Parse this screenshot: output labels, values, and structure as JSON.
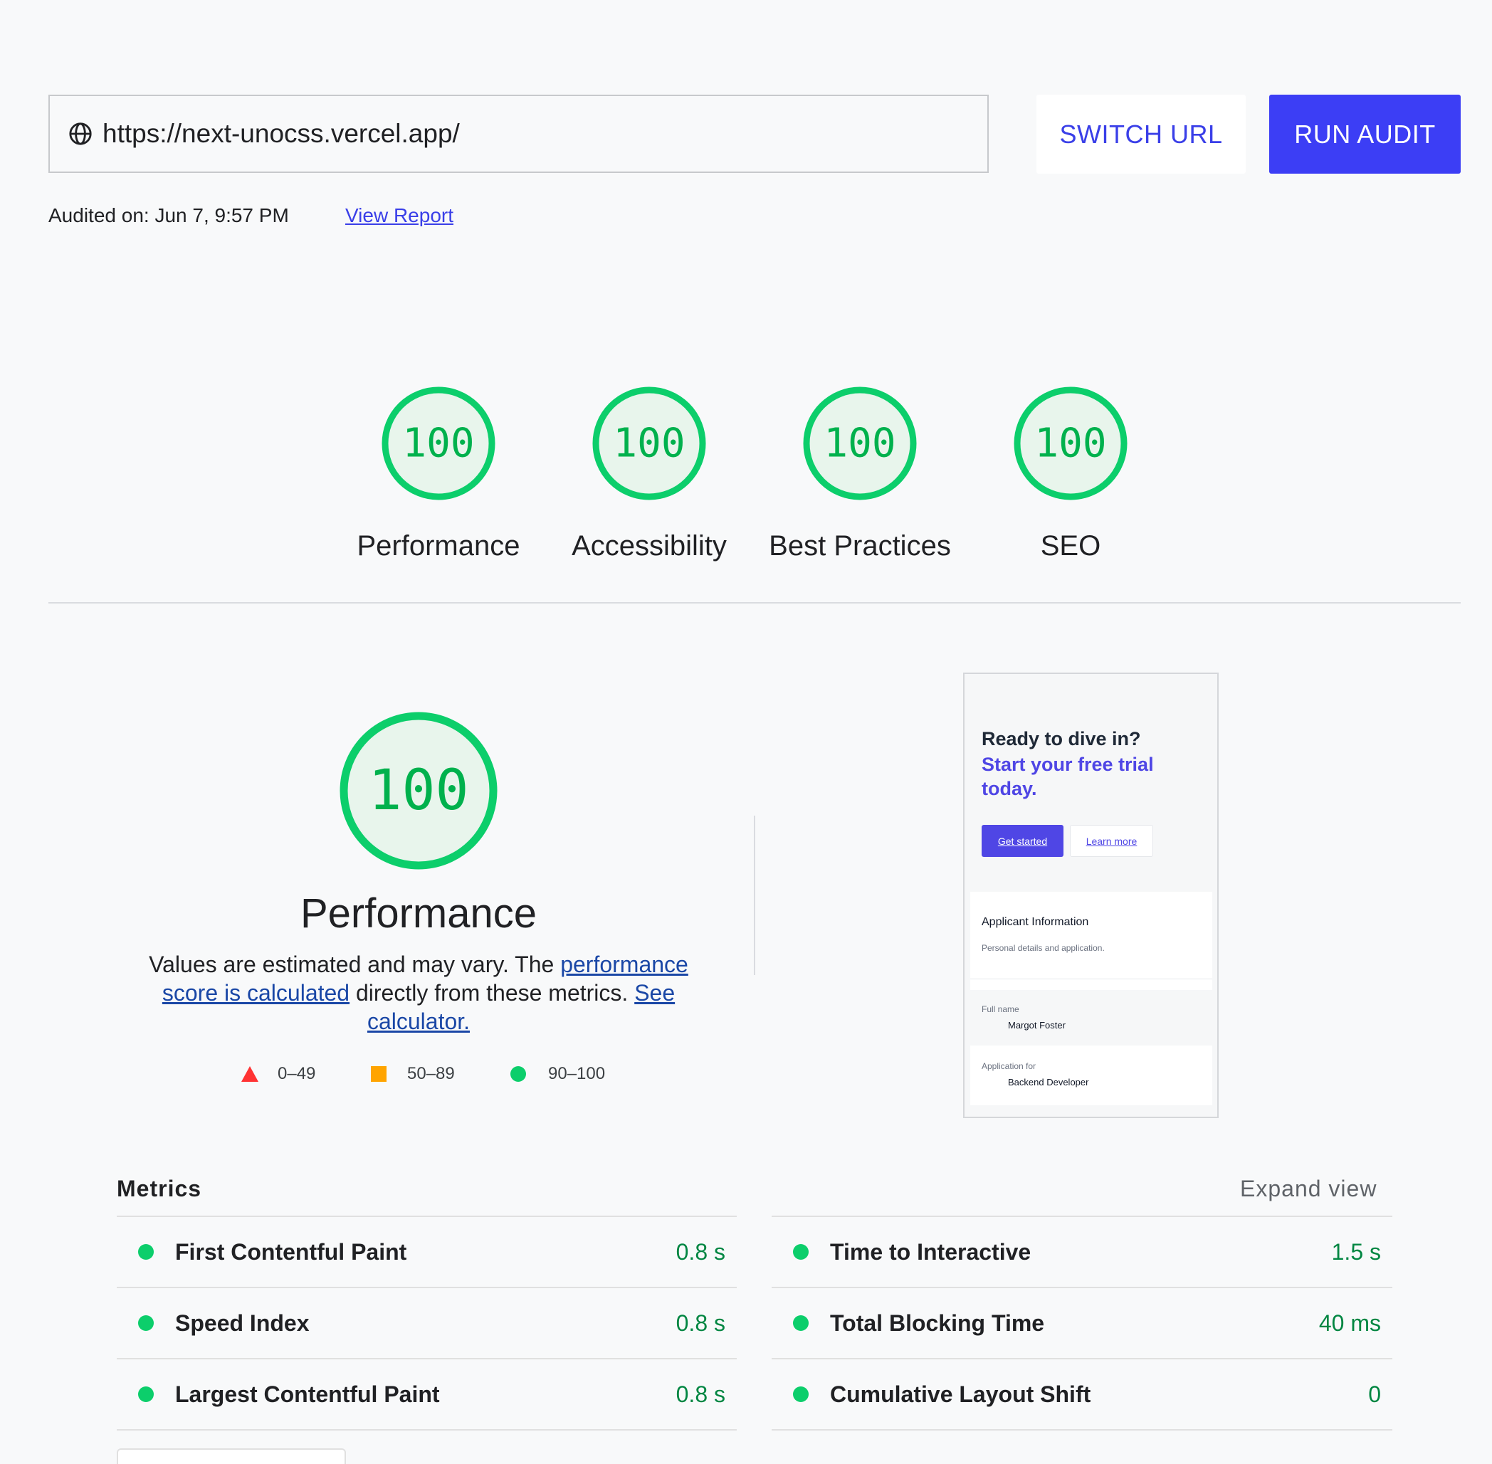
{
  "url_bar": {
    "url": "https://next-unocss.vercel.app/",
    "icon": "globe-icon"
  },
  "buttons": {
    "switch_url": "SWITCH URL",
    "run_audit": "RUN AUDIT"
  },
  "audit": {
    "audited_on": "Audited on: Jun 7, 9:57 PM",
    "view_report": "View Report"
  },
  "scores": [
    {
      "label": "Performance",
      "score": "100"
    },
    {
      "label": "Accessibility",
      "score": "100"
    },
    {
      "label": "Best Practices",
      "score": "100"
    },
    {
      "label": "SEO",
      "score": "100"
    }
  ],
  "performance": {
    "score": "100",
    "title": "Performance",
    "desc_1": "Values are estimated and may vary. The ",
    "desc_link_1": "performance score is calculated",
    "desc_2": " directly from these metrics. ",
    "desc_link_2": "See calculator.",
    "legend": [
      {
        "shape": "triangle",
        "range": "0–49",
        "color": "#ff3333"
      },
      {
        "shape": "square",
        "range": "50–89",
        "color": "#ffa400"
      },
      {
        "shape": "circle",
        "range": "90–100",
        "color": "#0cce6b"
      }
    ]
  },
  "thumbnail": {
    "heading_1": "Ready to dive in?",
    "heading_2": "Start your free trial today.",
    "get_started": "Get started",
    "learn_more": "Learn more",
    "card_title": "Applicant Information",
    "card_sub": "Personal details and application.",
    "field_1_label": "Full name",
    "field_1_value": "Margot Foster",
    "field_2_label": "Application for",
    "field_2_value": "Backend Developer"
  },
  "metrics": {
    "title": "Metrics",
    "expand": "Expand view",
    "left": [
      {
        "name": "First Contentful Paint",
        "value": "0.8 s"
      },
      {
        "name": "Speed Index",
        "value": "0.8 s"
      },
      {
        "name": "Largest Contentful Paint",
        "value": "0.8 s"
      }
    ],
    "right": [
      {
        "name": "Time to Interactive",
        "value": "1.5 s"
      },
      {
        "name": "Total Blocking Time",
        "value": "40 ms"
      },
      {
        "name": "Cumulative Layout Shift",
        "value": "0"
      }
    ]
  },
  "colors": {
    "accent": "#3c3ef5",
    "pass": "#0cce6b",
    "pass_text": "#018642",
    "gauge_fill": "#e8f5ec"
  }
}
